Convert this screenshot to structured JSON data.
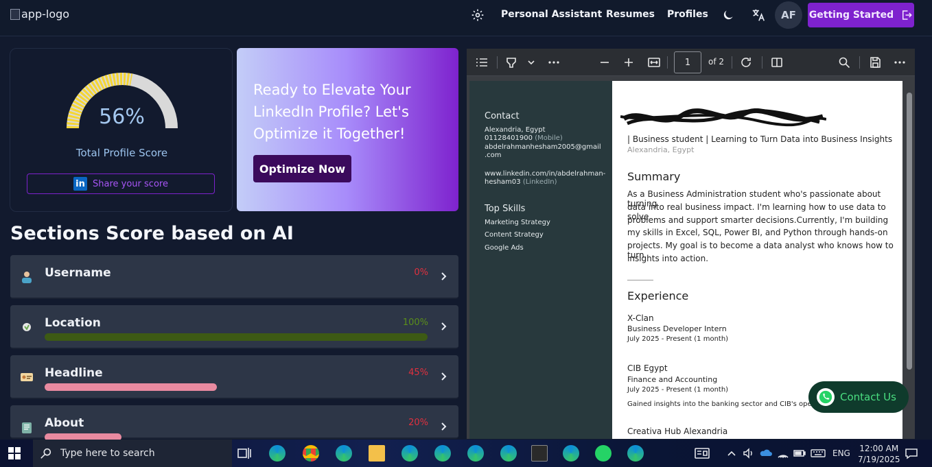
{
  "nav": {
    "logo_alt": "app-logo",
    "links": [
      "Personal Assistant",
      "Resumes",
      "Profiles"
    ],
    "avatar_initials": "AF",
    "cta": "Getting Started"
  },
  "score": {
    "value": "56%",
    "fraction": 0.56,
    "label": "Total Profile Score",
    "share": "Share your score"
  },
  "promo": {
    "text": "Ready to Elevate Your LinkedIn Profile? Let's Optimize it Together!",
    "button": "Optimize Now"
  },
  "sections_title": "Sections Score based on AI",
  "sections": [
    {
      "name": "Username",
      "percent": "0%",
      "value": 0,
      "color": "#e0303e",
      "bar": ""
    },
    {
      "name": "Location",
      "percent": "100%",
      "value": 100,
      "color": "#5a8f1a",
      "bar": "#3d5a14"
    },
    {
      "name": "Headline",
      "percent": "45%",
      "value": 45,
      "color": "#e0303e",
      "bar": "#e88aa0"
    },
    {
      "name": "About",
      "percent": "20%",
      "value": 20,
      "color": "#e0303e",
      "bar": "#e88aa0"
    }
  ],
  "pdf": {
    "page": "1",
    "of": "of 2",
    "left": {
      "contact_h": "Contact",
      "address": "Alexandria, Egypt",
      "phone": "01128401900",
      "phone_tag": "(Mobile)",
      "email1": "abdelrahmanhesham2005@gmail",
      "email2": ".com",
      "linkedin1": "www.linkedin.com/in/abdelrahman-",
      "linkedin2": "hesham03",
      "linkedin_tag": "(LinkedIn)",
      "skills_h": "Top Skills",
      "skills": [
        "Marketing Strategy",
        "Content Strategy",
        "Google Ads"
      ]
    },
    "right": {
      "tagline": "| Business student | Learning to Turn Data into Business Insights",
      "location": "Alexandria, Egypt",
      "summary_h": "Summary",
      "summary": [
        "As a Business Administration student who's passionate about turning",
        "data into real business impact. I'm learning how to use data to solve",
        "problems and support smarter decisions.Currently, I'm building",
        "my skills in Excel, SQL, Power BI, and Python through hands-on",
        "projects. My goal is to become a data analyst who knows how to turn",
        "insights into action."
      ],
      "experience_h": "Experience",
      "jobs": [
        {
          "company": "X-Clan",
          "title": "Business Developer Intern",
          "dates": "July 2025 - Present (1 month)"
        },
        {
          "company": "CIB Egypt",
          "title": "Finance and Accounting",
          "dates": "July 2025 - Present (1 month)",
          "desc": "Gained insights into the banking sector and CIB's opera"
        },
        {
          "company": "Creativa Hub Alexandria"
        }
      ]
    }
  },
  "whatsapp": "Contact Us",
  "taskbar": {
    "search": "Type here to search",
    "lang": "ENG",
    "time": "12:00 AM",
    "date": "7/19/2025"
  }
}
